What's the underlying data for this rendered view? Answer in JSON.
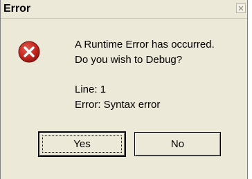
{
  "window": {
    "title": "Error",
    "close_icon": "close-icon"
  },
  "message": {
    "icon": "error-icon",
    "line1": "A Runtime Error has occurred.",
    "line2": "Do you wish to Debug?",
    "detail_line": "Line: 1",
    "detail_error": "Error: Syntax error"
  },
  "buttons": {
    "yes_label": "Yes",
    "no_label": "No"
  },
  "colors": {
    "dialog_bg": "#ece9d8",
    "icon_red": "#c3271e"
  }
}
